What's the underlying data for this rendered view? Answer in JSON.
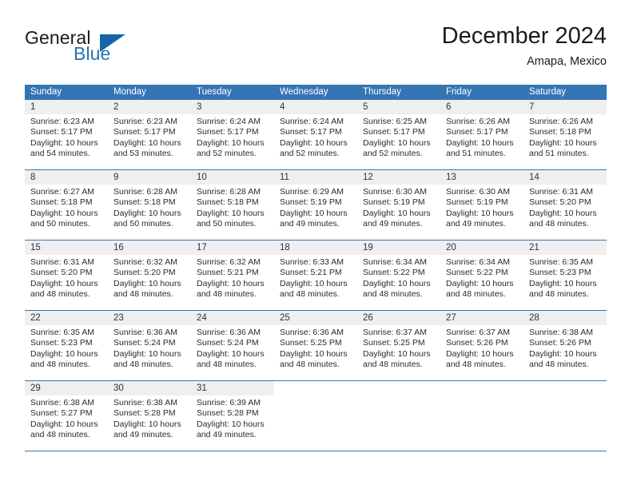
{
  "brand": {
    "name_part1": "General",
    "name_part2": "Blue"
  },
  "header": {
    "title": "December 2024",
    "location": "Amapa, Mexico"
  },
  "colors": {
    "header_blue": "#3575b4",
    "brand_blue": "#2572b8",
    "triangle_blue": "#1565a8",
    "daynum_bg": "#efefef"
  },
  "weekdays": [
    "Sunday",
    "Monday",
    "Tuesday",
    "Wednesday",
    "Thursday",
    "Friday",
    "Saturday"
  ],
  "weeks": [
    [
      {
        "day": "1",
        "sunrise": "Sunrise: 6:23 AM",
        "sunset": "Sunset: 5:17 PM",
        "daylight1": "Daylight: 10 hours",
        "daylight2": "and 54 minutes."
      },
      {
        "day": "2",
        "sunrise": "Sunrise: 6:23 AM",
        "sunset": "Sunset: 5:17 PM",
        "daylight1": "Daylight: 10 hours",
        "daylight2": "and 53 minutes."
      },
      {
        "day": "3",
        "sunrise": "Sunrise: 6:24 AM",
        "sunset": "Sunset: 5:17 PM",
        "daylight1": "Daylight: 10 hours",
        "daylight2": "and 52 minutes."
      },
      {
        "day": "4",
        "sunrise": "Sunrise: 6:24 AM",
        "sunset": "Sunset: 5:17 PM",
        "daylight1": "Daylight: 10 hours",
        "daylight2": "and 52 minutes."
      },
      {
        "day": "5",
        "sunrise": "Sunrise: 6:25 AM",
        "sunset": "Sunset: 5:17 PM",
        "daylight1": "Daylight: 10 hours",
        "daylight2": "and 52 minutes."
      },
      {
        "day": "6",
        "sunrise": "Sunrise: 6:26 AM",
        "sunset": "Sunset: 5:17 PM",
        "daylight1": "Daylight: 10 hours",
        "daylight2": "and 51 minutes."
      },
      {
        "day": "7",
        "sunrise": "Sunrise: 6:26 AM",
        "sunset": "Sunset: 5:18 PM",
        "daylight1": "Daylight: 10 hours",
        "daylight2": "and 51 minutes."
      }
    ],
    [
      {
        "day": "8",
        "sunrise": "Sunrise: 6:27 AM",
        "sunset": "Sunset: 5:18 PM",
        "daylight1": "Daylight: 10 hours",
        "daylight2": "and 50 minutes."
      },
      {
        "day": "9",
        "sunrise": "Sunrise: 6:28 AM",
        "sunset": "Sunset: 5:18 PM",
        "daylight1": "Daylight: 10 hours",
        "daylight2": "and 50 minutes."
      },
      {
        "day": "10",
        "sunrise": "Sunrise: 6:28 AM",
        "sunset": "Sunset: 5:18 PM",
        "daylight1": "Daylight: 10 hours",
        "daylight2": "and 50 minutes."
      },
      {
        "day": "11",
        "sunrise": "Sunrise: 6:29 AM",
        "sunset": "Sunset: 5:19 PM",
        "daylight1": "Daylight: 10 hours",
        "daylight2": "and 49 minutes."
      },
      {
        "day": "12",
        "sunrise": "Sunrise: 6:30 AM",
        "sunset": "Sunset: 5:19 PM",
        "daylight1": "Daylight: 10 hours",
        "daylight2": "and 49 minutes."
      },
      {
        "day": "13",
        "sunrise": "Sunrise: 6:30 AM",
        "sunset": "Sunset: 5:19 PM",
        "daylight1": "Daylight: 10 hours",
        "daylight2": "and 49 minutes."
      },
      {
        "day": "14",
        "sunrise": "Sunrise: 6:31 AM",
        "sunset": "Sunset: 5:20 PM",
        "daylight1": "Daylight: 10 hours",
        "daylight2": "and 48 minutes."
      }
    ],
    [
      {
        "day": "15",
        "sunrise": "Sunrise: 6:31 AM",
        "sunset": "Sunset: 5:20 PM",
        "daylight1": "Daylight: 10 hours",
        "daylight2": "and 48 minutes."
      },
      {
        "day": "16",
        "sunrise": "Sunrise: 6:32 AM",
        "sunset": "Sunset: 5:20 PM",
        "daylight1": "Daylight: 10 hours",
        "daylight2": "and 48 minutes."
      },
      {
        "day": "17",
        "sunrise": "Sunrise: 6:32 AM",
        "sunset": "Sunset: 5:21 PM",
        "daylight1": "Daylight: 10 hours",
        "daylight2": "and 48 minutes."
      },
      {
        "day": "18",
        "sunrise": "Sunrise: 6:33 AM",
        "sunset": "Sunset: 5:21 PM",
        "daylight1": "Daylight: 10 hours",
        "daylight2": "and 48 minutes."
      },
      {
        "day": "19",
        "sunrise": "Sunrise: 6:34 AM",
        "sunset": "Sunset: 5:22 PM",
        "daylight1": "Daylight: 10 hours",
        "daylight2": "and 48 minutes."
      },
      {
        "day": "20",
        "sunrise": "Sunrise: 6:34 AM",
        "sunset": "Sunset: 5:22 PM",
        "daylight1": "Daylight: 10 hours",
        "daylight2": "and 48 minutes."
      },
      {
        "day": "21",
        "sunrise": "Sunrise: 6:35 AM",
        "sunset": "Sunset: 5:23 PM",
        "daylight1": "Daylight: 10 hours",
        "daylight2": "and 48 minutes."
      }
    ],
    [
      {
        "day": "22",
        "sunrise": "Sunrise: 6:35 AM",
        "sunset": "Sunset: 5:23 PM",
        "daylight1": "Daylight: 10 hours",
        "daylight2": "and 48 minutes."
      },
      {
        "day": "23",
        "sunrise": "Sunrise: 6:36 AM",
        "sunset": "Sunset: 5:24 PM",
        "daylight1": "Daylight: 10 hours",
        "daylight2": "and 48 minutes."
      },
      {
        "day": "24",
        "sunrise": "Sunrise: 6:36 AM",
        "sunset": "Sunset: 5:24 PM",
        "daylight1": "Daylight: 10 hours",
        "daylight2": "and 48 minutes."
      },
      {
        "day": "25",
        "sunrise": "Sunrise: 6:36 AM",
        "sunset": "Sunset: 5:25 PM",
        "daylight1": "Daylight: 10 hours",
        "daylight2": "and 48 minutes."
      },
      {
        "day": "26",
        "sunrise": "Sunrise: 6:37 AM",
        "sunset": "Sunset: 5:25 PM",
        "daylight1": "Daylight: 10 hours",
        "daylight2": "and 48 minutes."
      },
      {
        "day": "27",
        "sunrise": "Sunrise: 6:37 AM",
        "sunset": "Sunset: 5:26 PM",
        "daylight1": "Daylight: 10 hours",
        "daylight2": "and 48 minutes."
      },
      {
        "day": "28",
        "sunrise": "Sunrise: 6:38 AM",
        "sunset": "Sunset: 5:26 PM",
        "daylight1": "Daylight: 10 hours",
        "daylight2": "and 48 minutes."
      }
    ],
    [
      {
        "day": "29",
        "sunrise": "Sunrise: 6:38 AM",
        "sunset": "Sunset: 5:27 PM",
        "daylight1": "Daylight: 10 hours",
        "daylight2": "and 48 minutes."
      },
      {
        "day": "30",
        "sunrise": "Sunrise: 6:38 AM",
        "sunset": "Sunset: 5:28 PM",
        "daylight1": "Daylight: 10 hours",
        "daylight2": "and 49 minutes."
      },
      {
        "day": "31",
        "sunrise": "Sunrise: 6:39 AM",
        "sunset": "Sunset: 5:28 PM",
        "daylight1": "Daylight: 10 hours",
        "daylight2": "and 49 minutes."
      },
      {
        "day": "",
        "sunrise": "",
        "sunset": "",
        "daylight1": "",
        "daylight2": ""
      },
      {
        "day": "",
        "sunrise": "",
        "sunset": "",
        "daylight1": "",
        "daylight2": ""
      },
      {
        "day": "",
        "sunrise": "",
        "sunset": "",
        "daylight1": "",
        "daylight2": ""
      },
      {
        "day": "",
        "sunrise": "",
        "sunset": "",
        "daylight1": "",
        "daylight2": ""
      }
    ]
  ]
}
